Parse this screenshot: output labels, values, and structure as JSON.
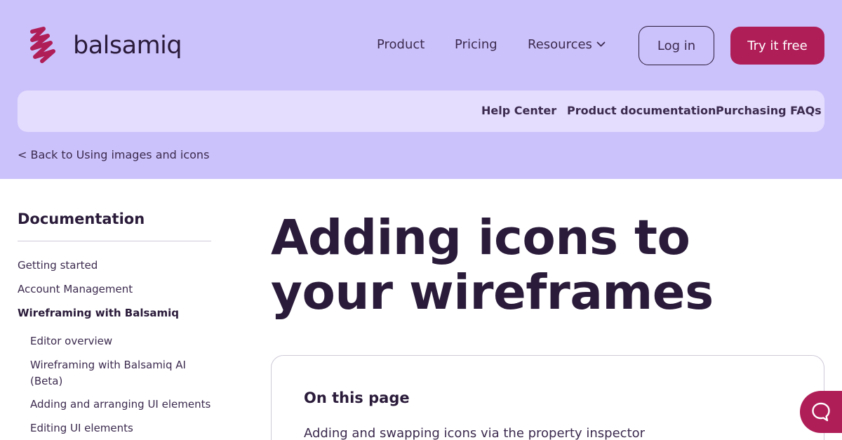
{
  "brand": {
    "name": "balsamiq",
    "accent": "#b01e58",
    "header_bg": "#ccc2fb",
    "subnav_bg": "#e4ddfe"
  },
  "nav": {
    "items": [
      {
        "label": "Product"
      },
      {
        "label": "Pricing"
      },
      {
        "label": "Resources"
      }
    ],
    "login_label": "Log in",
    "try_label": "Try it free"
  },
  "subnav": {
    "items": [
      {
        "label": "Help Center"
      },
      {
        "label": "Product documentation"
      },
      {
        "label": "Purchasing FAQs"
      }
    ]
  },
  "back_link": "< Back to Using images and icons",
  "sidebar": {
    "title": "Documentation",
    "items": [
      {
        "label": "Getting started"
      },
      {
        "label": "Account Management"
      },
      {
        "label": "Wireframing with Balsamiq"
      }
    ],
    "subitems": [
      {
        "label": "Editor overview"
      },
      {
        "label": "Wireframing with Balsamiq AI (Beta)"
      },
      {
        "label": "Adding and arranging UI elements"
      },
      {
        "label": "Editing UI elements"
      }
    ]
  },
  "main": {
    "title": "Adding icons to your wireframes",
    "toc": {
      "title": "On this page",
      "links": [
        {
          "label": "Adding and swapping icons via the property inspector"
        }
      ]
    }
  },
  "icons": {
    "logo": "squiggle-logo-icon",
    "resources_chevron": "chevron-down-icon",
    "help": "chat-bubble-icon"
  }
}
